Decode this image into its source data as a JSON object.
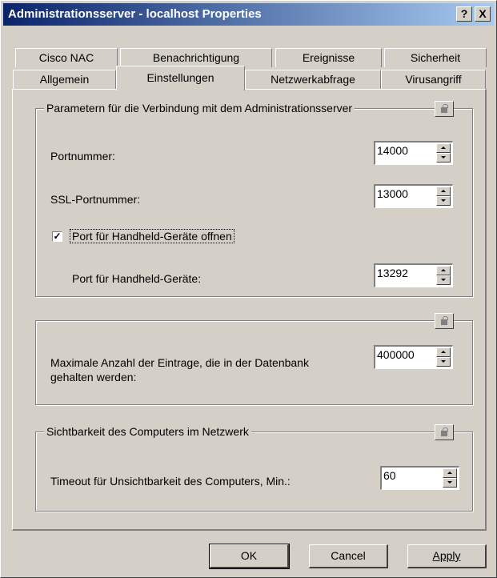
{
  "window": {
    "title": "Administrationsserver - localhost Properties",
    "help_label": "?",
    "close_label": "X"
  },
  "tabs_row1": [
    {
      "label": "Cisco NAC"
    },
    {
      "label": "Benachrichtigung"
    },
    {
      "label": "Ereignisse"
    },
    {
      "label": "Sicherheit"
    }
  ],
  "tabs_row2": [
    {
      "label": "Allgemein"
    },
    {
      "label": "Einstellungen"
    },
    {
      "label": "Netzwerkabfrage"
    },
    {
      "label": "Virusangriff"
    }
  ],
  "active_tab": "Einstellungen",
  "group1": {
    "title": "Parametern für die Verbindung mit dem Administrationsserver",
    "port_label": "Portnummer:",
    "port_value": "14000",
    "ssl_label": "SSL-Portnummer:",
    "ssl_value": "13000",
    "handheld_checkbox_label": "Port  für Handheld-Geräte offnen",
    "handheld_checked": true,
    "handheld_port_label": "Port  für Handheld-Geräte:",
    "handheld_port_value": "13292"
  },
  "group2": {
    "label_line1": "Maximale Anzahl der Eintrage, die in der Datenbank",
    "label_line2": "gehalten werden:",
    "value": "400000"
  },
  "group3": {
    "title": "Sichtbarkeit des Computers im Netzwerk",
    "timeout_label": "Timeout für Unsichtbarkeit des Computers, Min.:",
    "timeout_value": "60"
  },
  "buttons": {
    "ok": "OK",
    "cancel": "Cancel",
    "apply": "Apply"
  }
}
